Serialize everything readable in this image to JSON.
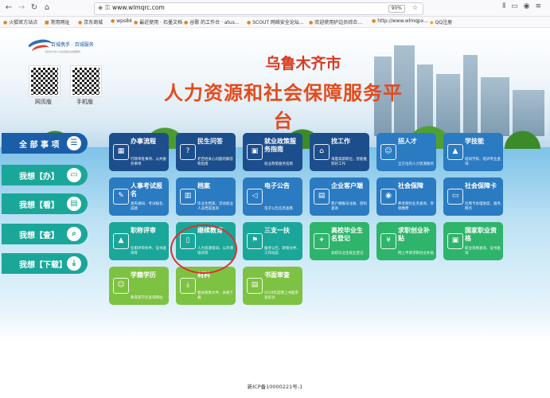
{
  "browser": {
    "url": "www.wlmqrc.com",
    "zoom": "90%",
    "bookmarks": [
      "火狐官方站点",
      "常用网址",
      "京东商城",
      "wps84",
      "最近使用 · 石墨文档",
      "谷歌 的工作台 · atus...",
      "SCOUT 网络安全论坛...",
      "欢迎使用护边员综合...",
      "http://www.wlmqpx...",
      "QQ注册"
    ]
  },
  "header": {
    "logo_name": "百城携手 · 百城服务",
    "logo_sub": "乌鲁木齐市人力资源和社会保障局",
    "title_line1": "乌鲁木齐市",
    "title_line2": "人力资源和社会保障服务平台",
    "qr_web_label": "网页版",
    "qr_mobile_label": "手机版"
  },
  "sidebar": [
    {
      "label": "全 部 事 项",
      "icon": "list-icon",
      "color": "#1b5ea8"
    },
    {
      "label": "我想【办】",
      "icon": "monitor-icon",
      "color": "#1aa79a"
    },
    {
      "label": "我想【看】",
      "icon": "book-icon",
      "color": "#1aa79a"
    },
    {
      "label": "我想【查】",
      "icon": "search-icon",
      "color": "#1aa79a"
    },
    {
      "label": "我想【下载】",
      "icon": "download-icon",
      "color": "#1aa79a"
    }
  ],
  "tiles": [
    {
      "title": "办事流程",
      "desc": "行政审批事项、公共服务事项",
      "icon": "flowchart-icon",
      "color": "c-navy"
    },
    {
      "title": "民生问答",
      "desc": "老百姓关心问题的解答和指南",
      "icon": "qa-icon",
      "color": "c-navy"
    },
    {
      "title": "就业政策服务指南",
      "desc": "就业政策服务指南",
      "icon": "briefcase-icon",
      "color": "c-navy"
    },
    {
      "title": "找工作",
      "desc": "海量高薪职位，智能推荐好工作",
      "icon": "job-icon",
      "color": "c-navy"
    },
    {
      "title": "招人才",
      "desc": "全方位的人力资源服务",
      "icon": "person-icon",
      "color": "c-mid"
    },
    {
      "title": "学技能",
      "desc": "培训学校、培训专业查询",
      "icon": "graduation-icon",
      "color": "c-mid"
    },
    {
      "title": "人事考试报名",
      "desc": "发布通知、考试报名、成绩",
      "icon": "exam-icon",
      "color": "c-mid"
    },
    {
      "title": "档案",
      "desc": "毕业生档案、流动就业人员档案查询",
      "icon": "archive-icon",
      "color": "c-mid"
    },
    {
      "title": "电子公告",
      "desc": "电子公告信息查看",
      "icon": "megaphone-icon",
      "color": "c-mid"
    },
    {
      "title": "企业客户端",
      "desc": "客户端账号注册、密码查询",
      "icon": "building-icon",
      "color": "c-mid"
    },
    {
      "title": "社会保障",
      "desc": "养老保险业务查询、参保缴费",
      "icon": "shield-icon",
      "color": "c-mid"
    },
    {
      "title": "社会保障卡",
      "desc": "社保卡办理进度、服务网点",
      "icon": "card-icon",
      "color": "c-mid"
    },
    {
      "title": "职称评审",
      "desc": "任职评审条件、证书查询等",
      "icon": "cap-icon",
      "color": "c-teal"
    },
    {
      "title": "继续教育",
      "desc": "人力资源培训，公开课培训等",
      "icon": "book-open-icon",
      "color": "c-teal"
    },
    {
      "title": "三支一扶",
      "desc": "报考公告、政策文件、工作动态",
      "icon": "flag-icon",
      "color": "c-teal"
    },
    {
      "title": "高校毕业生名登记",
      "desc": "高校毕业生就业登记",
      "icon": "certificate-icon",
      "color": "c-green"
    },
    {
      "title": "求职创业补贴",
      "desc": "网上申请求职创业补贴",
      "icon": "money-icon",
      "color": "c-green"
    },
    {
      "title": "国家职业资格",
      "desc": "职业资格查询、证书查询",
      "icon": "license-icon",
      "color": "c-green"
    },
    {
      "title": "学籍学历",
      "desc": "教育部学历查询网站",
      "icon": "student-icon",
      "color": "c-lime"
    },
    {
      "title": "材料",
      "desc": "相关政策文件、表格下载",
      "icon": "download-tray-icon",
      "color": "c-lime"
    },
    {
      "title": "书面审查",
      "desc": "2019年度网上书面审查投诉",
      "icon": "document-icon",
      "color": "c-lime"
    }
  ],
  "footer": {
    "icp": "新ICP备10000221号-1"
  }
}
